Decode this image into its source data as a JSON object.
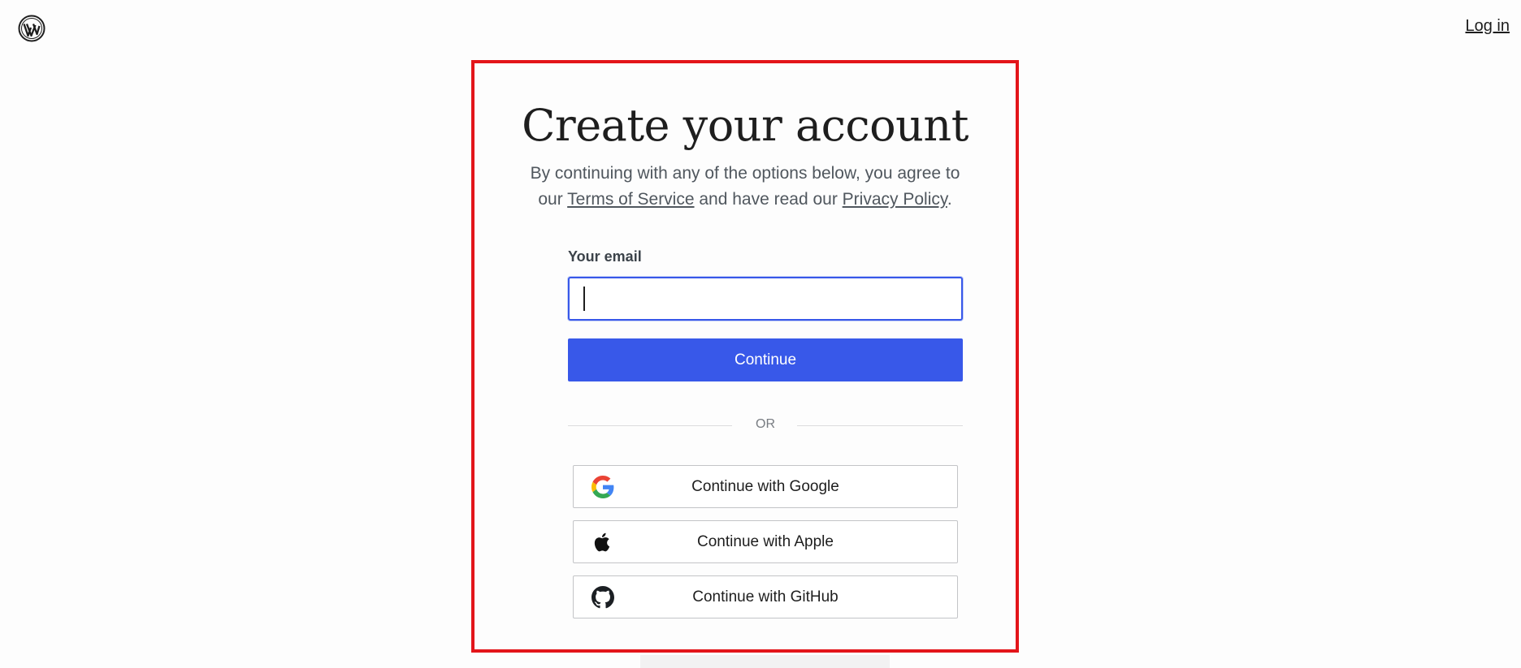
{
  "header": {
    "logo_icon": "wordpress-logo-icon",
    "login_label": "Log in"
  },
  "main": {
    "title": "Create your account",
    "subtitle": {
      "part1": "By continuing with any of the options below, you agree to our ",
      "terms_link": "Terms of Service",
      "part2": " and have read our ",
      "privacy_link": "Privacy Policy",
      "part3": "."
    },
    "email": {
      "label": "Your email",
      "value": "",
      "placeholder": ""
    },
    "continue_label": "Continue",
    "divider_label": "OR",
    "social": [
      {
        "label": "Continue with Google",
        "icon": "google-icon"
      },
      {
        "label": "Continue with Apple",
        "icon": "apple-icon"
      },
      {
        "label": "Continue with GitHub",
        "icon": "github-icon"
      }
    ]
  },
  "colors": {
    "accent": "#3858e9",
    "highlight": "#e3151a",
    "text_muted": "#50575e"
  }
}
